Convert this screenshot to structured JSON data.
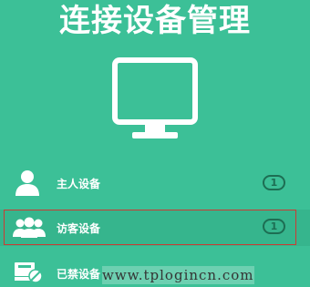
{
  "page_title": "连接设备管理",
  "icons": {
    "monitor": "monitor-icon",
    "host": "user-icon",
    "guest": "users-icon",
    "blocked": "blocked-device-icon"
  },
  "colors": {
    "background": "#3cc097",
    "badge": "#1d6e53",
    "highlight": "#cc3a33"
  },
  "devices": [
    {
      "label": "主人设备",
      "count": "1"
    },
    {
      "label": "访客设备",
      "count": "1",
      "highlighted": true
    },
    {
      "label": "已禁设备"
    }
  ],
  "watermark": "www.tplogincn.com"
}
